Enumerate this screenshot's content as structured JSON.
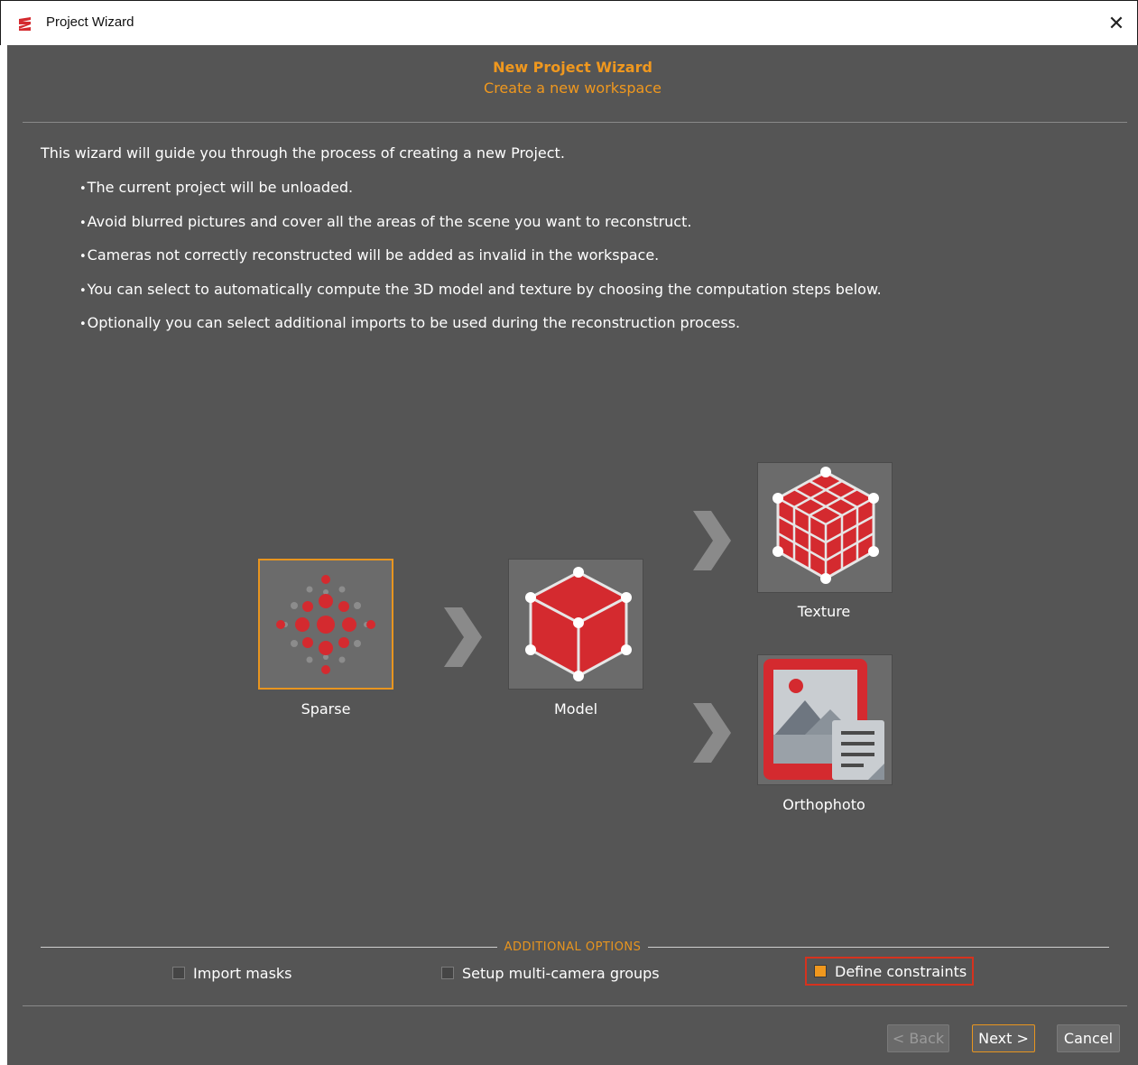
{
  "window": {
    "title": "Project Wizard",
    "close_glyph": "✕"
  },
  "header": {
    "title": "New Project Wizard",
    "subtitle": "Create a new workspace"
  },
  "intro": "This wizard will guide you through the process of creating a new Project.",
  "bullets": [
    "The current project will be unloaded.",
    "Avoid blurred pictures and cover all the areas of the scene you want to reconstruct.",
    "Cameras not correctly reconstructed will be added as invalid in the workspace.",
    "You can select to automatically compute the 3D model and texture by choosing the computation steps below.",
    "Optionally you can select additional imports to be used during the reconstruction process."
  ],
  "steps": {
    "sparse": {
      "label": "Sparse",
      "icon": "sparse-points-icon",
      "selected": true
    },
    "model": {
      "label": "Model",
      "icon": "cube-mesh-icon"
    },
    "texture": {
      "label": "Texture",
      "icon": "textured-cube-icon"
    },
    "orthophoto": {
      "label": "Orthophoto",
      "icon": "orthophoto-image-icon"
    }
  },
  "additional_options": {
    "heading": "ADDITIONAL OPTIONS",
    "options": [
      {
        "label": "Import masks",
        "checked": false
      },
      {
        "label": "Setup multi-camera groups",
        "checked": false
      },
      {
        "label": "Define constraints",
        "checked": true
      }
    ]
  },
  "buttons": {
    "back": "< Back",
    "next": "Next >",
    "cancel": "Cancel"
  },
  "colors": {
    "accent": "#f0981e",
    "background": "#555555",
    "icon_red": "#d42a2f",
    "focus_border": "#d6321e"
  }
}
